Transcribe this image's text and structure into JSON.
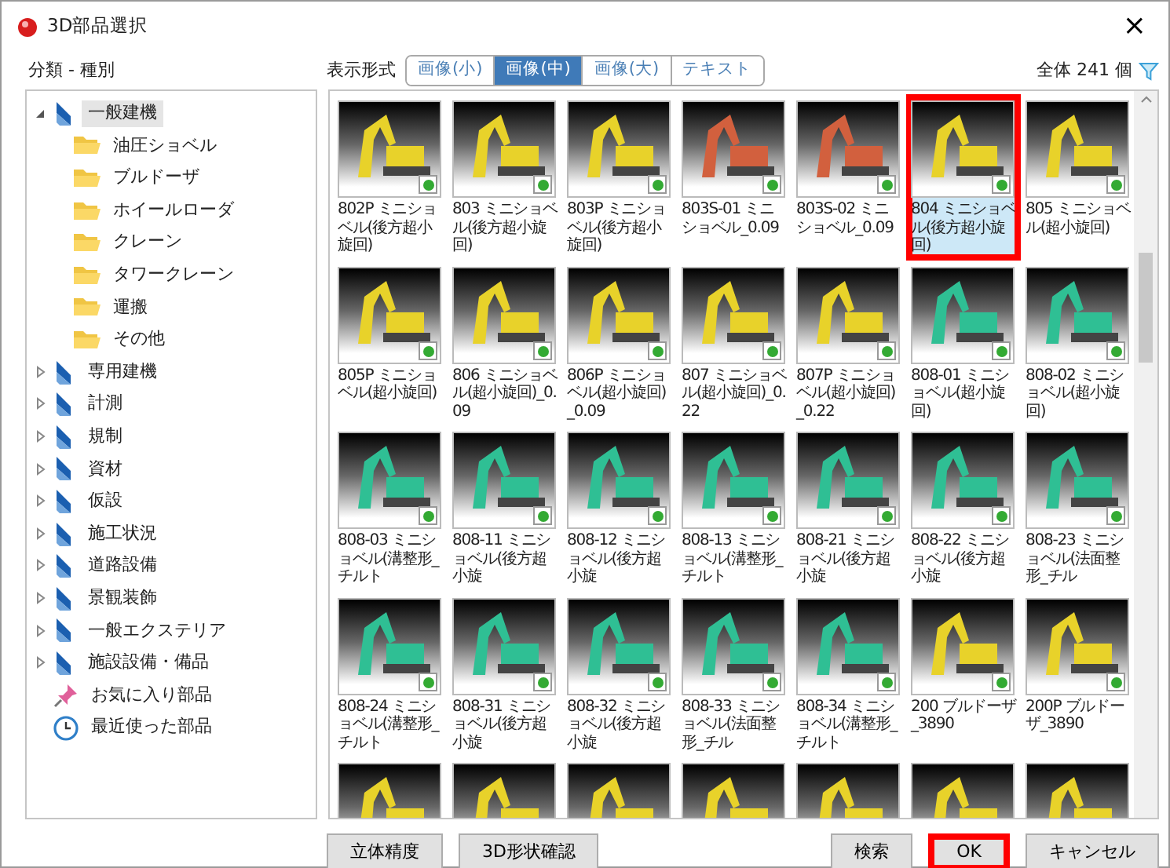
{
  "window": {
    "title": "3D部品選択",
    "close": "×"
  },
  "category_label": "分類 - 種別",
  "view_label": "表示形式",
  "view_tabs": [
    {
      "label": "画像(小)",
      "selected": false
    },
    {
      "label": "画像(中)",
      "selected": true
    },
    {
      "label": "画像(大)",
      "selected": false
    },
    {
      "label": "テキスト",
      "selected": false
    }
  ],
  "total": "全体 241 個",
  "tree": [
    {
      "label": "一般建機",
      "kind": "book",
      "expanded": true,
      "selected": true,
      "children": [
        {
          "label": "油圧ショベル"
        },
        {
          "label": "ブルドーザ"
        },
        {
          "label": "ホイールローダ"
        },
        {
          "label": "クレーン"
        },
        {
          "label": "タワークレーン"
        },
        {
          "label": "運搬"
        },
        {
          "label": "その他"
        }
      ]
    },
    {
      "label": "専用建機",
      "kind": "book",
      "expanded": false,
      "selected": false
    },
    {
      "label": "計測",
      "kind": "book",
      "expanded": false,
      "selected": false
    },
    {
      "label": "規制",
      "kind": "book",
      "expanded": false,
      "selected": false
    },
    {
      "label": "資材",
      "kind": "book",
      "expanded": false,
      "selected": false
    },
    {
      "label": "仮設",
      "kind": "book",
      "expanded": false,
      "selected": false
    },
    {
      "label": "施工状況",
      "kind": "book",
      "expanded": false,
      "selected": false
    },
    {
      "label": "道路設備",
      "kind": "book",
      "expanded": false,
      "selected": false
    },
    {
      "label": "景観装飾",
      "kind": "book",
      "expanded": false,
      "selected": false
    },
    {
      "label": "一般エクステリア",
      "kind": "book",
      "expanded": false,
      "selected": false
    },
    {
      "label": "施設設備・備品",
      "kind": "book",
      "expanded": false,
      "selected": false
    },
    {
      "label": "お気に入り部品",
      "kind": "pin",
      "selected": false
    },
    {
      "label": "最近使った部品",
      "kind": "clock",
      "selected": false
    }
  ],
  "parts": [
    {
      "name": "802P ミニショベル(後方超小旋回)",
      "color": "#e8d22a",
      "selected": false,
      "highlighted": false
    },
    {
      "name": "803 ミニショベル(後方超小旋回)",
      "color": "#e8d22a",
      "selected": false,
      "highlighted": false
    },
    {
      "name": "803P ミニショベル(後方超小旋回)",
      "color": "#e8d22a",
      "selected": false,
      "highlighted": false
    },
    {
      "name": "803S-01 ミニショベル_0.09",
      "color": "#d2603e",
      "selected": false,
      "highlighted": false
    },
    {
      "name": "803S-02 ミニショベル_0.09",
      "color": "#d2603e",
      "selected": false,
      "highlighted": false
    },
    {
      "name": "804 ミニショベル(後方超小旋回)",
      "color": "#e8d22a",
      "selected": true,
      "highlighted": true
    },
    {
      "name": "805 ミニショベル(超小旋回)",
      "color": "#e8d22a",
      "selected": false,
      "highlighted": false
    },
    {
      "name": "805P ミニショベル(超小旋回)",
      "color": "#e8d22a",
      "selected": false,
      "highlighted": false
    },
    {
      "name": "806 ミニショベル(超小旋回)_0.09",
      "color": "#e8d22a",
      "selected": false,
      "highlighted": false
    },
    {
      "name": "806P ミニショベル(超小旋回)_0.09",
      "color": "#e8d22a",
      "selected": false,
      "highlighted": false
    },
    {
      "name": "807 ミニショベル(超小旋回)_0.22",
      "color": "#e8d22a",
      "selected": false,
      "highlighted": false
    },
    {
      "name": "807P ミニショベル(超小旋回)_0.22",
      "color": "#e8d22a",
      "selected": false,
      "highlighted": false
    },
    {
      "name": "808-01 ミニショベル(超小旋回)",
      "color": "#2fbf94",
      "selected": false,
      "highlighted": false
    },
    {
      "name": "808-02 ミニショベル(超小旋回)",
      "color": "#2fbf94",
      "selected": false,
      "highlighted": false
    },
    {
      "name": "808-03 ミニショベル(溝整形_チルト",
      "color": "#2fbf94",
      "selected": false,
      "highlighted": false
    },
    {
      "name": "808-11 ミニショベル(後方超小旋",
      "color": "#2fbf94",
      "selected": false,
      "highlighted": false
    },
    {
      "name": "808-12 ミニショベル(後方超小旋",
      "color": "#2fbf94",
      "selected": false,
      "highlighted": false
    },
    {
      "name": "808-13 ミニショベル(溝整形_チルト",
      "color": "#2fbf94",
      "selected": false,
      "highlighted": false
    },
    {
      "name": "808-21 ミニショベル(後方超小旋",
      "color": "#2fbf94",
      "selected": false,
      "highlighted": false
    },
    {
      "name": "808-22 ミニショベル(後方超小旋",
      "color": "#2fbf94",
      "selected": false,
      "highlighted": false
    },
    {
      "name": "808-23 ミニショベル(法面整形_チル",
      "color": "#2fbf94",
      "selected": false,
      "highlighted": false
    },
    {
      "name": "808-24 ミニショベル(溝整形_チルト",
      "color": "#2fbf94",
      "selected": false,
      "highlighted": false
    },
    {
      "name": "808-31 ミニショベル(後方超小旋",
      "color": "#2fbf94",
      "selected": false,
      "highlighted": false
    },
    {
      "name": "808-32 ミニショベル(後方超小旋",
      "color": "#2fbf94",
      "selected": false,
      "highlighted": false
    },
    {
      "name": "808-33 ミニショベル(法面整形_チル",
      "color": "#2fbf94",
      "selected": false,
      "highlighted": false
    },
    {
      "name": "808-34 ミニショベル(溝整形_チルト",
      "color": "#2fbf94",
      "selected": false,
      "highlighted": false
    },
    {
      "name": "200 ブルドーザ_3890",
      "color": "#e8d22a",
      "selected": false,
      "highlighted": false
    },
    {
      "name": "200P ブルドーザ_3890",
      "color": "#e8d22a",
      "selected": false,
      "highlighted": false
    },
    {
      "color": "#e8d22a"
    },
    {
      "color": "#e8d22a"
    },
    {
      "color": "#e8d22a"
    },
    {
      "color": "#e8d22a"
    },
    {
      "color": "#e8d22a"
    },
    {
      "color": "#e8d22a"
    },
    {
      "color": "#e8d22a"
    }
  ],
  "left_buttons": [
    {
      "label": "立体精度",
      "highlighted": false
    },
    {
      "label": "3D形状確認",
      "highlighted": false
    }
  ],
  "right_buttons": [
    {
      "label": "検索",
      "highlighted": false
    },
    {
      "label": "OK",
      "highlighted": true
    },
    {
      "label": "キャンセル",
      "highlighted": false
    }
  ]
}
